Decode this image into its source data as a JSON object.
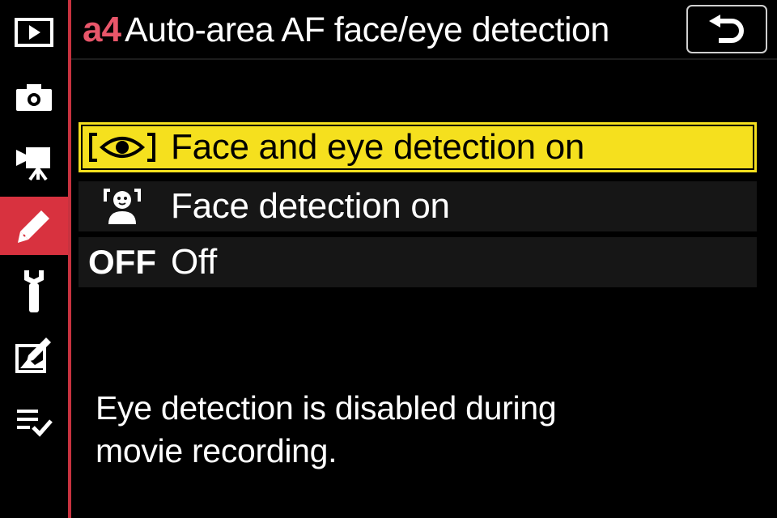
{
  "sidebar": {
    "items": [
      {
        "icon": "playback-menu-icon"
      },
      {
        "icon": "photo-shooting-menu-icon"
      },
      {
        "icon": "movie-shooting-menu-icon"
      },
      {
        "icon": "custom-settings-pencil-icon",
        "active": true
      },
      {
        "icon": "setup-wrench-icon"
      },
      {
        "icon": "retouch-menu-icon"
      },
      {
        "icon": "my-menu-icon"
      }
    ]
  },
  "header": {
    "code": "a4",
    "title": "Auto-area AF face/eye detection",
    "back_icon": "return-arrow-icon"
  },
  "options": [
    {
      "icon": "face-eye-detection-icon",
      "label": "Face and eye detection on",
      "selected": true
    },
    {
      "icon": "face-detection-icon",
      "label": "Face detection on",
      "selected": false
    },
    {
      "icon_text": "OFF",
      "label": "Off",
      "selected": false
    }
  ],
  "help_text": {
    "line1": "Eye detection is disabled during",
    "line2": "movie recording."
  },
  "colors": {
    "accent_red": "#d8323f",
    "code_pink": "#e8566a",
    "highlight_yellow": "#f5e01e",
    "row_bg": "#161616"
  }
}
